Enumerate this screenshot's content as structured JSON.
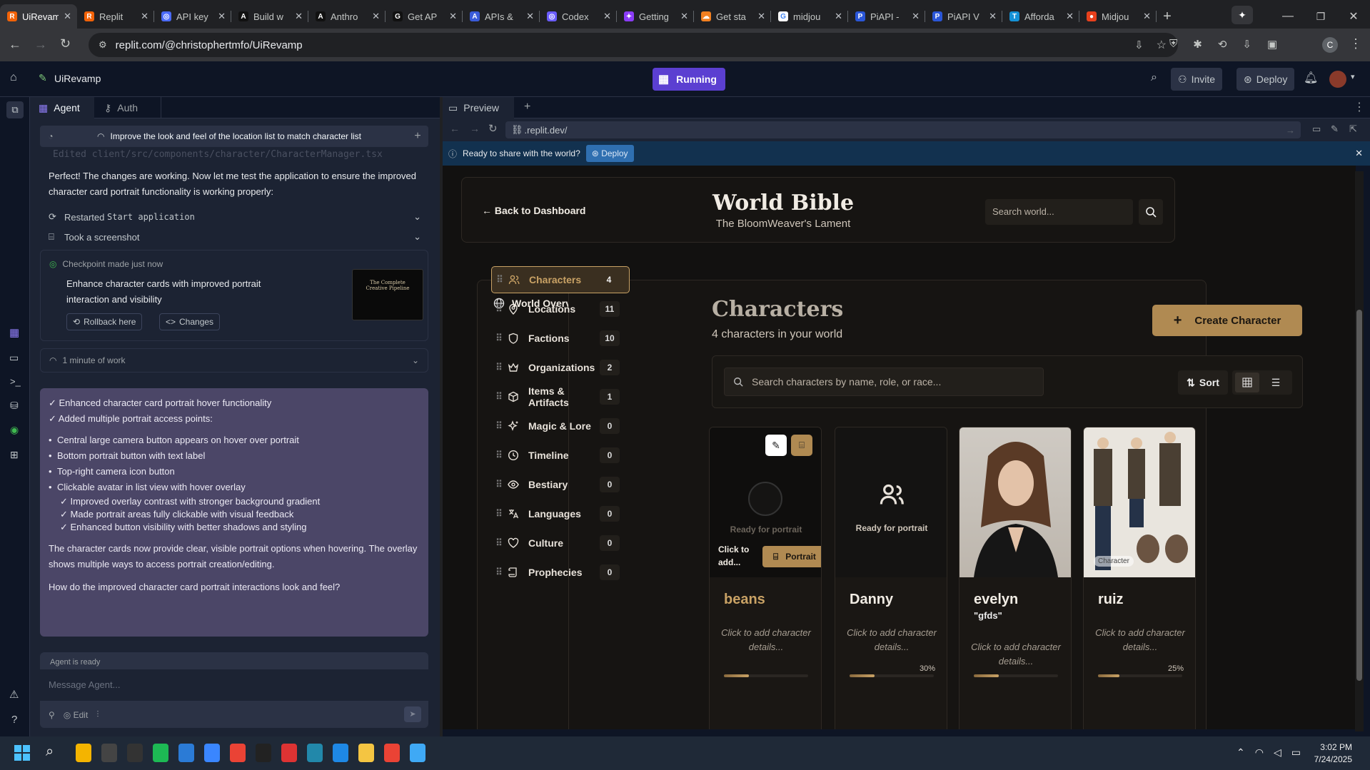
{
  "browser": {
    "tabs": [
      {
        "title": "UiRevamp",
        "icon": "replit-icon",
        "color": "#f26207",
        "glyph": "R",
        "active": true
      },
      {
        "title": "Replit",
        "icon": "replit-icon",
        "color": "#f26207",
        "glyph": "R"
      },
      {
        "title": "API key",
        "icon": "openai-icon",
        "color": "#4b6bfb",
        "glyph": "◎"
      },
      {
        "title": "Build w",
        "icon": "anthropic-icon",
        "color": "#111111",
        "glyph": "A"
      },
      {
        "title": "Anthro",
        "icon": "anthropic-icon",
        "color": "#111111",
        "glyph": "A"
      },
      {
        "title": "Get AP",
        "icon": "github-icon",
        "color": "#111111",
        "glyph": "G"
      },
      {
        "title": "APIs &",
        "icon": "api-icon",
        "color": "#3a5bd9",
        "glyph": "A"
      },
      {
        "title": "Codex",
        "icon": "codex-icon",
        "color": "#6a5cff",
        "glyph": "◎"
      },
      {
        "title": "Getting",
        "icon": "sparkle-icon",
        "color": "#8b3cf7",
        "glyph": "✦"
      },
      {
        "title": "Get sta",
        "icon": "cloudflare-icon",
        "color": "#f38020",
        "glyph": "☁"
      },
      {
        "title": "midjou",
        "icon": "google-icon",
        "color": "#ffffff",
        "glyph": "G"
      },
      {
        "title": "PiAPI -",
        "icon": "piapi-icon",
        "color": "#2a56d8",
        "glyph": "P"
      },
      {
        "title": "PiAPI V",
        "icon": "piapi-icon",
        "color": "#2a56d8",
        "glyph": "P"
      },
      {
        "title": "Afforda",
        "icon": "t-icon",
        "color": "#1591d6",
        "glyph": "T"
      },
      {
        "title": "Midjou",
        "icon": "dot-icon",
        "color": "#e8401c",
        "glyph": "●"
      }
    ],
    "url": "replit.com/@christophertmfo/UiRevamp",
    "avatar_letter": "C"
  },
  "replit": {
    "project_name": "UiRevamp",
    "run_status": "Running",
    "invite_label": "Invite",
    "deploy_label": "Deploy",
    "agent_tabs": [
      "Agent",
      "Auth"
    ],
    "task_title": "Improve the look and feel of the location list to match character list",
    "edited_file": "Edited client/src/components/character/CharacterManager.tsx",
    "message_1": "Perfect! The changes are working. Now let me test the application to ensure the improved character card portrait functionality is working properly:",
    "restarted_label": "Restarted",
    "restarted_code": "Start application",
    "screenshot_label": "Took a screenshot",
    "checkpoint_label": "Checkpoint made just now",
    "checkpoint_title": "Enhance character cards with improved portrait interaction and visibility",
    "rollback_label": "Rollback here",
    "changes_label": "Changes",
    "work_label": "1 minute of work",
    "summary_checks": [
      "✓ Enhanced character card portrait hover functionality",
      "✓ Added multiple portrait access points:"
    ],
    "summary_bullets": [
      "Central large camera button appears on hover over portrait",
      "Bottom portrait button with text label",
      "Top-right camera icon button",
      "Clickable avatar in list view with hover overlay"
    ],
    "summary_sub_checks": [
      "✓ Improved overlay contrast with stronger background gradient",
      "✓ Made portrait areas fully clickable with visual feedback",
      "✓ Enhanced button visibility with better shadows and styling"
    ],
    "summary_para": "The character cards now provide clear, visible portrait options when hovering. The overlay shows multiple ways to access portrait creation/editing.",
    "summary_question": "How do the improved character card portrait interactions look and feel?",
    "agent_status": "Agent is ready",
    "message_placeholder": "Message Agent...",
    "edit_label": "Edit",
    "thumb_lines": [
      "The Complete",
      "Creative Pipeline"
    ]
  },
  "preview": {
    "tab_label": "Preview",
    "url": ".replit.dev/",
    "banner_text": "Ready to share with the world?",
    "banner_button": "Deploy"
  },
  "app": {
    "back_label": "← Back to Dashboard",
    "title": "World Bible",
    "subtitle": "The BloomWeaver's Lament",
    "search_placeholder": "Search world...",
    "overview_label": "World Overview",
    "nav": [
      {
        "label": "Characters",
        "count": "4",
        "icon": "users-icon",
        "active": true
      },
      {
        "label": "Locations",
        "count": "11",
        "icon": "map-pin-icon"
      },
      {
        "label": "Factions",
        "count": "10",
        "icon": "shield-icon"
      },
      {
        "label": "Organizations",
        "count": "2",
        "icon": "crown-icon"
      },
      {
        "label": "Items & Artifacts",
        "count": "1",
        "icon": "box-icon"
      },
      {
        "label": "Magic & Lore",
        "count": "0",
        "icon": "sparkles-icon"
      },
      {
        "label": "Timeline",
        "count": "0",
        "icon": "clock-icon"
      },
      {
        "label": "Bestiary",
        "count": "0",
        "icon": "eye-icon"
      },
      {
        "label": "Languages",
        "count": "0",
        "icon": "languages-icon"
      },
      {
        "label": "Culture",
        "count": "0",
        "icon": "heart-icon"
      },
      {
        "label": "Prophecies",
        "count": "0",
        "icon": "scroll-icon"
      }
    ],
    "section_title": "Characters",
    "section_subtitle": "4 characters in your world",
    "create_label": "Create Character",
    "char_search_placeholder": "Search characters by name, role, or race...",
    "sort_label": "Sort",
    "characters": [
      {
        "name": "beans",
        "subtitle": "",
        "portrait_text": "Ready for portrait",
        "hover_text": "Click to add...",
        "portrait_button": "Portrait",
        "details": "Click to add character details...",
        "progress": "0.3"
      },
      {
        "name": "Danny",
        "subtitle": "",
        "portrait_text": "Ready for portrait",
        "details": "Click to add character details...",
        "progress": "0.3",
        "progress_label": "30%"
      },
      {
        "name": "evelyn",
        "subtitle": "\"gfds\"",
        "details": "Click to add character details...",
        "progress": "0.3"
      },
      {
        "name": "ruiz",
        "subtitle": "",
        "badge": "Character",
        "details": "Click to add character details...",
        "progress": "0.25",
        "progress_label": "25%"
      }
    ],
    "accent": "#c9a265"
  },
  "system": {
    "time": "3:02 PM",
    "date": "7/24/2025"
  }
}
